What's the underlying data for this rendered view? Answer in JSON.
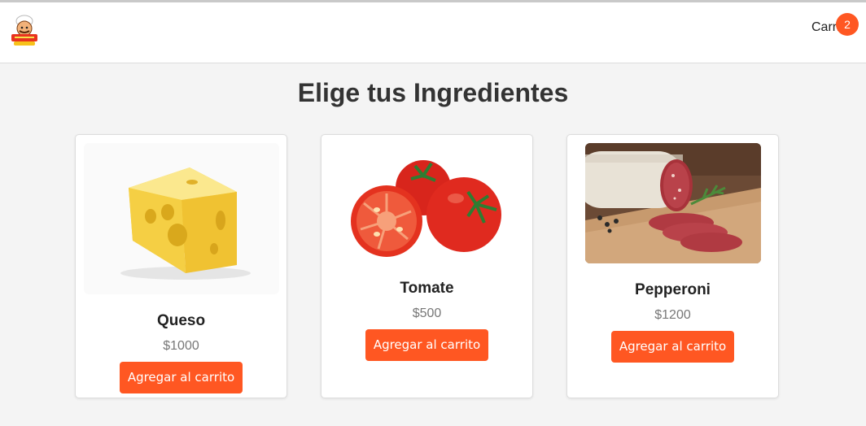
{
  "header": {
    "cart_label": "Carrito",
    "cart_count": "2"
  },
  "page": {
    "title": "Elige tus Ingredientes"
  },
  "products": [
    {
      "name": "Queso",
      "price": "$1000",
      "button_label": "Agregar al carrito",
      "image": "cheese-image"
    },
    {
      "name": "Tomate",
      "price": "$500",
      "button_label": "Agregar al carrito",
      "image": "tomato-image"
    },
    {
      "name": "Pepperoni",
      "price": "$1200",
      "button_label": "Agregar al carrito",
      "image": "salami-image"
    }
  ],
  "colors": {
    "accent": "#ff5722",
    "background": "#f4f4f4",
    "card": "#ffffff"
  }
}
